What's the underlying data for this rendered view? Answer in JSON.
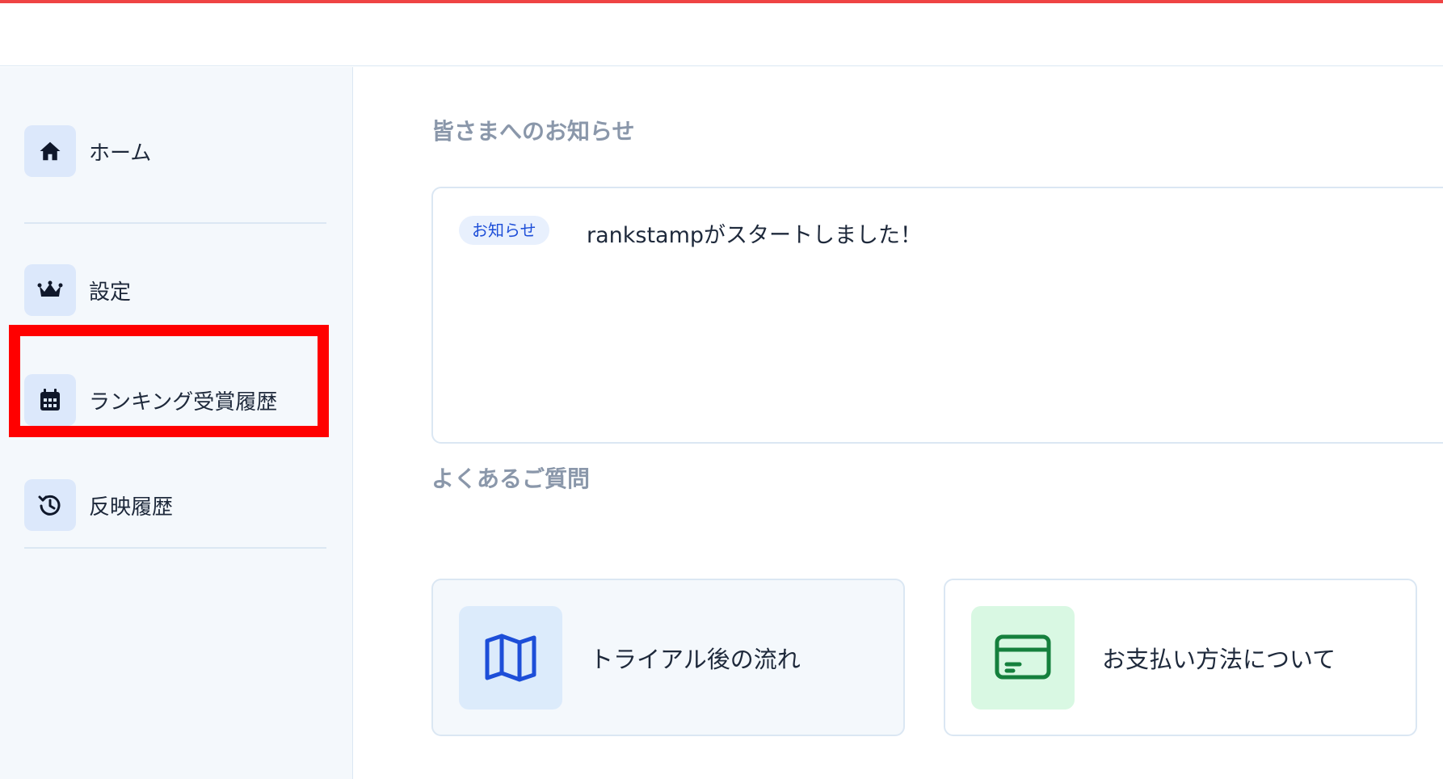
{
  "sidebar": {
    "items": [
      {
        "label": "ホーム",
        "icon": "home-icon"
      },
      {
        "label": "設定",
        "icon": "crown-icon"
      },
      {
        "label": "ランキング受賞履歴",
        "icon": "calendar-icon"
      },
      {
        "label": "反映履歴",
        "icon": "history-icon"
      }
    ]
  },
  "main": {
    "news_title": "皆さまへのお知らせ",
    "news": [
      {
        "badge": "お知らせ",
        "text": "rankstampがスタートしました！"
      }
    ],
    "faq_title": "よくあるご質問",
    "faq": [
      {
        "label": "トライアル後の流れ",
        "icon": "map-icon",
        "bg": "#dcebfb",
        "color": "#1d4ed8"
      },
      {
        "label": "お支払い方法について",
        "icon": "credit-card-icon",
        "bg": "#d9f8e3",
        "color": "#15803d"
      }
    ]
  },
  "colors": {
    "accent_red": "#ef4444",
    "highlight_red": "#ff0000",
    "icon_tile": "#dce8fb"
  }
}
